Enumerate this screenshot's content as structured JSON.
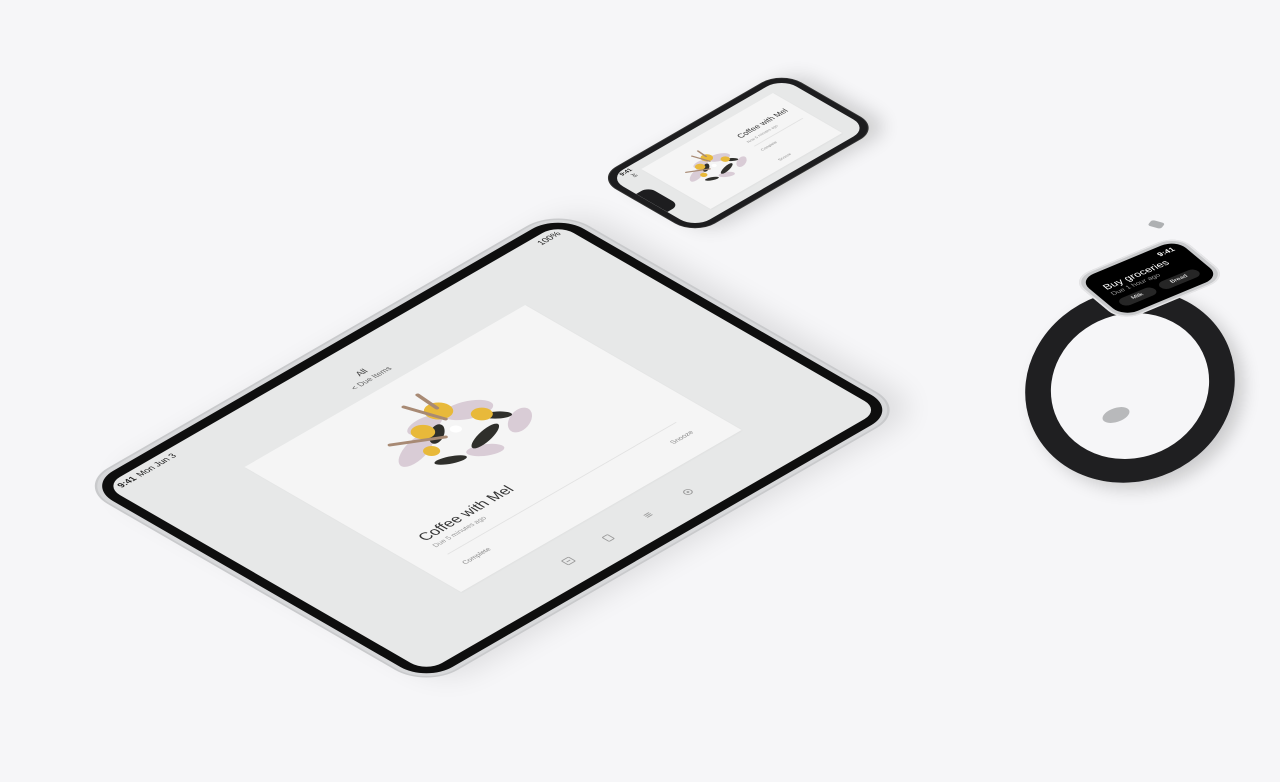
{
  "ipad": {
    "status": {
      "time": "9:41",
      "date": "Mon Jun 3",
      "right": "100%"
    },
    "nav": {
      "title": "All",
      "back": "< Due Items"
    },
    "card": {
      "title": "Coffee with Mel",
      "subtitle": "Due 5 minutes ago",
      "complete_label": "Complete",
      "snooze_label": "Snooze"
    }
  },
  "iphone": {
    "status": {
      "time": "9:41"
    },
    "nav": {
      "title": "All",
      "back": "< Due Items"
    },
    "card": {
      "title": "Coffee with Mel",
      "subtitle": "Now 5 minutes ago",
      "complete_label": "Complete",
      "snooze_label": "Snooze"
    }
  },
  "watch": {
    "time": "9:41",
    "title": "Buy groceries",
    "subtitle": "Due 1 hour ago",
    "chips": [
      "Milk",
      "Bread"
    ]
  },
  "colors": {
    "background": "#f6f6f8",
    "screen": "#e7e8e8",
    "card": "#f5f5f5",
    "gold": "#e8b93a",
    "lilac": "#d9ccd6",
    "dark": "#2f2f2b",
    "tan": "#a88a74"
  },
  "icons": [
    "tab-today-icon",
    "tab-scheduled-icon",
    "tab-list-icon",
    "tab-settings-icon"
  ]
}
